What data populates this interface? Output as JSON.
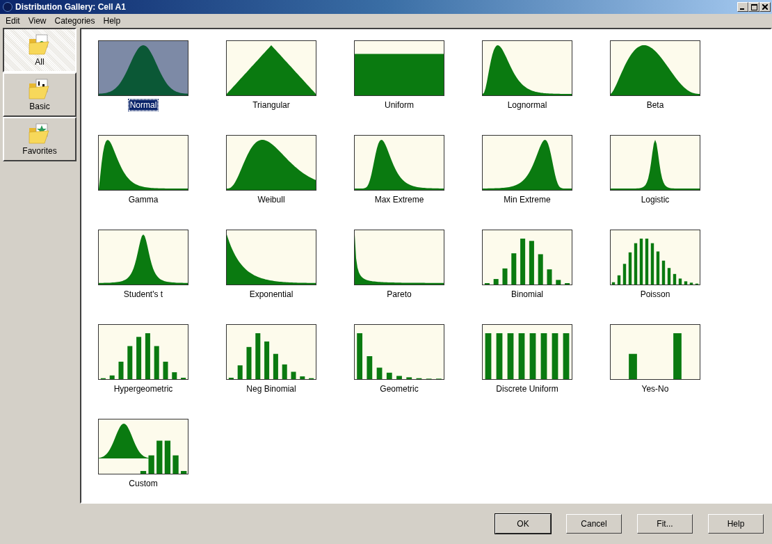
{
  "window": {
    "title": "Distribution Gallery: Cell A1"
  },
  "menu": [
    "Edit",
    "View",
    "Categories",
    "Help"
  ],
  "categories": [
    {
      "label": "All",
      "selected": true,
      "kind": "chart"
    },
    {
      "label": "Basic",
      "selected": false,
      "kind": "numbers"
    },
    {
      "label": "Favorites",
      "selected": false,
      "kind": "star"
    }
  ],
  "distributions": [
    {
      "label": "Normal",
      "kind": "normal",
      "selected": true
    },
    {
      "label": "Triangular",
      "kind": "triangular",
      "selected": false
    },
    {
      "label": "Uniform",
      "kind": "uniform",
      "selected": false
    },
    {
      "label": "Lognormal",
      "kind": "lognormal",
      "selected": false
    },
    {
      "label": "Beta",
      "kind": "beta",
      "selected": false
    },
    {
      "label": "Gamma",
      "kind": "gamma",
      "selected": false
    },
    {
      "label": "Weibull",
      "kind": "weibull",
      "selected": false
    },
    {
      "label": "Max Extreme",
      "kind": "maxextreme",
      "selected": false
    },
    {
      "label": "Min Extreme",
      "kind": "minextreme",
      "selected": false
    },
    {
      "label": "Logistic",
      "kind": "logistic",
      "selected": false
    },
    {
      "label": "Student's t",
      "kind": "studentt",
      "selected": false
    },
    {
      "label": "Exponential",
      "kind": "exponential",
      "selected": false
    },
    {
      "label": "Pareto",
      "kind": "pareto",
      "selected": false
    },
    {
      "label": "Binomial",
      "kind": "binomial",
      "selected": false
    },
    {
      "label": "Poisson",
      "kind": "poisson",
      "selected": false
    },
    {
      "label": "Hypergeometric",
      "kind": "hypergeometric",
      "selected": false
    },
    {
      "label": "Neg Binomial",
      "kind": "negbinomial",
      "selected": false
    },
    {
      "label": "Geometric",
      "kind": "geometric",
      "selected": false
    },
    {
      "label": "Discrete Uniform",
      "kind": "discreteuniform",
      "selected": false
    },
    {
      "label": "Yes-No",
      "kind": "yesno",
      "selected": false
    },
    {
      "label": "Custom",
      "kind": "custom",
      "selected": false
    }
  ],
  "buttons": [
    "OK",
    "Cancel",
    "Fit...",
    "Help"
  ]
}
